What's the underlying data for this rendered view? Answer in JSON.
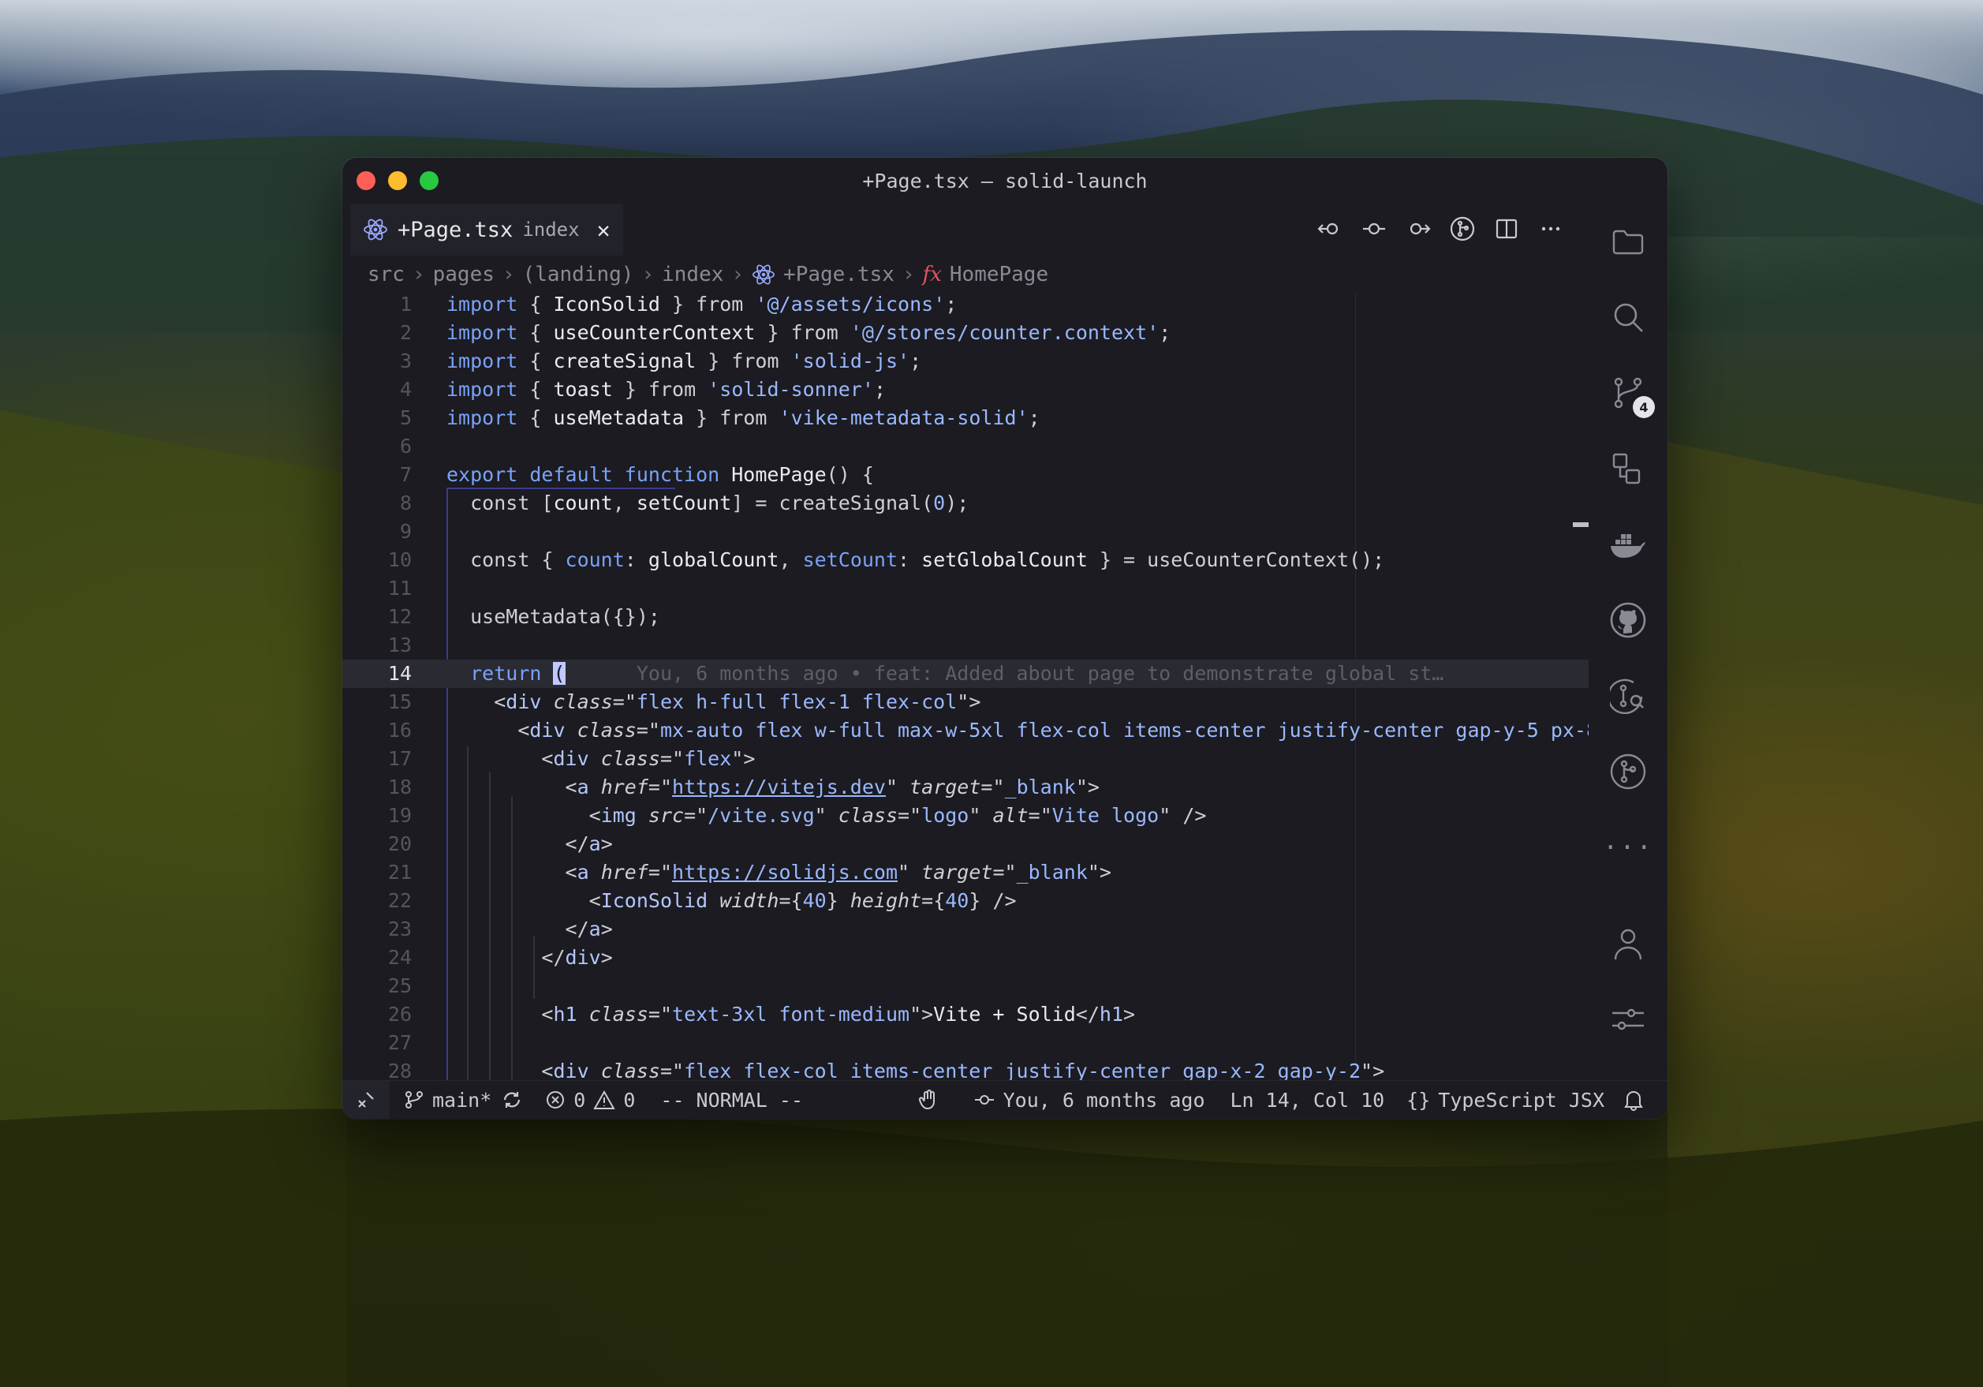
{
  "window": {
    "title": "+Page.tsx — solid-launch"
  },
  "tab": {
    "name": "+Page.tsx",
    "sub": "index",
    "close": "✕"
  },
  "breadcrumb": {
    "seg1": "src",
    "seg2": "pages",
    "seg3": "(landing)",
    "seg4": "index",
    "seg5": "+Page.tsx",
    "fn_icon": "fx",
    "seg6": "HomePage",
    "sep": "›"
  },
  "activity_bar": {
    "scm_badge": "4",
    "more": "···"
  },
  "editor": {
    "current_line": 14,
    "line_numbers": [
      "1",
      "2",
      "3",
      "4",
      "5",
      "6",
      "7",
      "8",
      "9",
      "10",
      "11",
      "12",
      "13",
      "14",
      "15",
      "16",
      "17",
      "18",
      "19",
      "20",
      "21",
      "22",
      "23",
      "24",
      "25",
      "26",
      "27",
      "28"
    ],
    "blame": "You, 6 months ago • feat: Added about page to demonstrate global st…"
  },
  "status": {
    "branch": "main*",
    "errors": "0",
    "warnings": "0",
    "mode": "-- NORMAL --",
    "blame": "You, 6 months ago",
    "position": "Ln 14, Col 10",
    "language": "TypeScript JSX"
  }
}
